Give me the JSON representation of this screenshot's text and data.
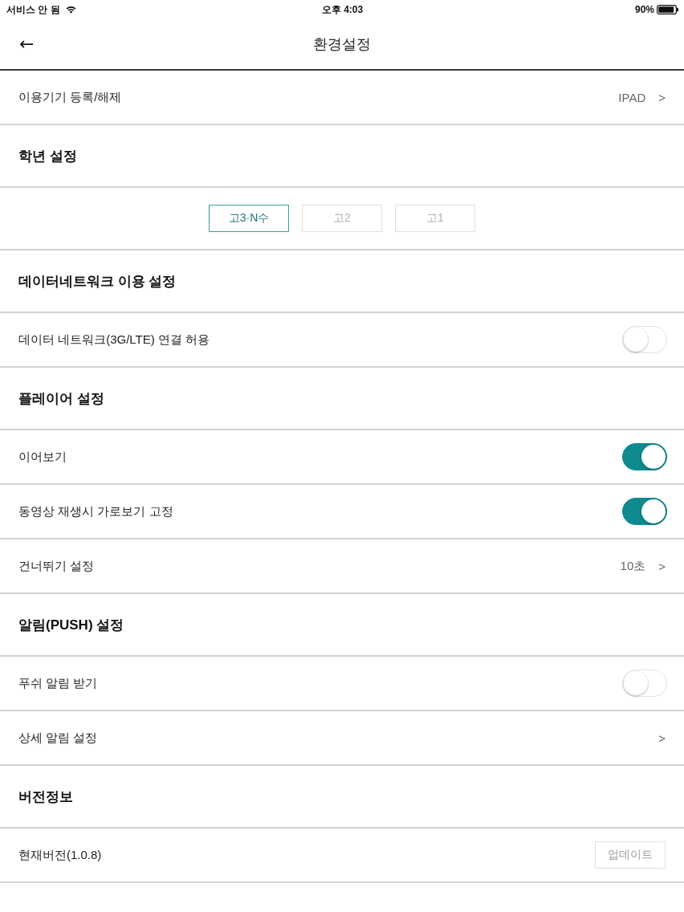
{
  "status_bar": {
    "carrier": "서비스 안 됨",
    "time": "오후 4:03",
    "battery": "90%"
  },
  "nav_bar": {
    "back": "←",
    "title": "환경설정"
  },
  "items": [
    {
      "kind": "link",
      "label": "이용기기 등록/해제",
      "value": "IPAD",
      "chevron": ">"
    },
    {
      "kind": "header",
      "label": "학년 설정"
    },
    {
      "kind": "segments",
      "options": [
        {
          "label": "고3·N수",
          "selected": true
        },
        {
          "label": "고2",
          "selected": false
        },
        {
          "label": "고1",
          "selected": false
        }
      ]
    },
    {
      "kind": "header",
      "label": "데이터네트워크 이용 설정"
    },
    {
      "kind": "toggle",
      "label": "데이터 네트워크(3G/LTE) 연결 허용",
      "on": false
    },
    {
      "kind": "header",
      "label": "플레이어 설정"
    },
    {
      "kind": "toggle",
      "label": "이어보기",
      "on": true
    },
    {
      "kind": "toggle",
      "label": "동영상 재생시 가로보기 고정",
      "on": true
    },
    {
      "kind": "link",
      "label": "건너뛰기 설정",
      "value": "10초",
      "chevron": ">"
    },
    {
      "kind": "header",
      "label": "알림(PUSH) 설정"
    },
    {
      "kind": "toggle",
      "label": "푸쉬 알림 받기",
      "on": false
    },
    {
      "kind": "link",
      "label": "상세 알림 설정",
      "chevron": ">"
    },
    {
      "kind": "header",
      "label": "버전정보"
    },
    {
      "kind": "action",
      "label": "현재버전(1.0.8)",
      "button": {
        "label": "업데이트",
        "disabled": true
      }
    }
  ]
}
